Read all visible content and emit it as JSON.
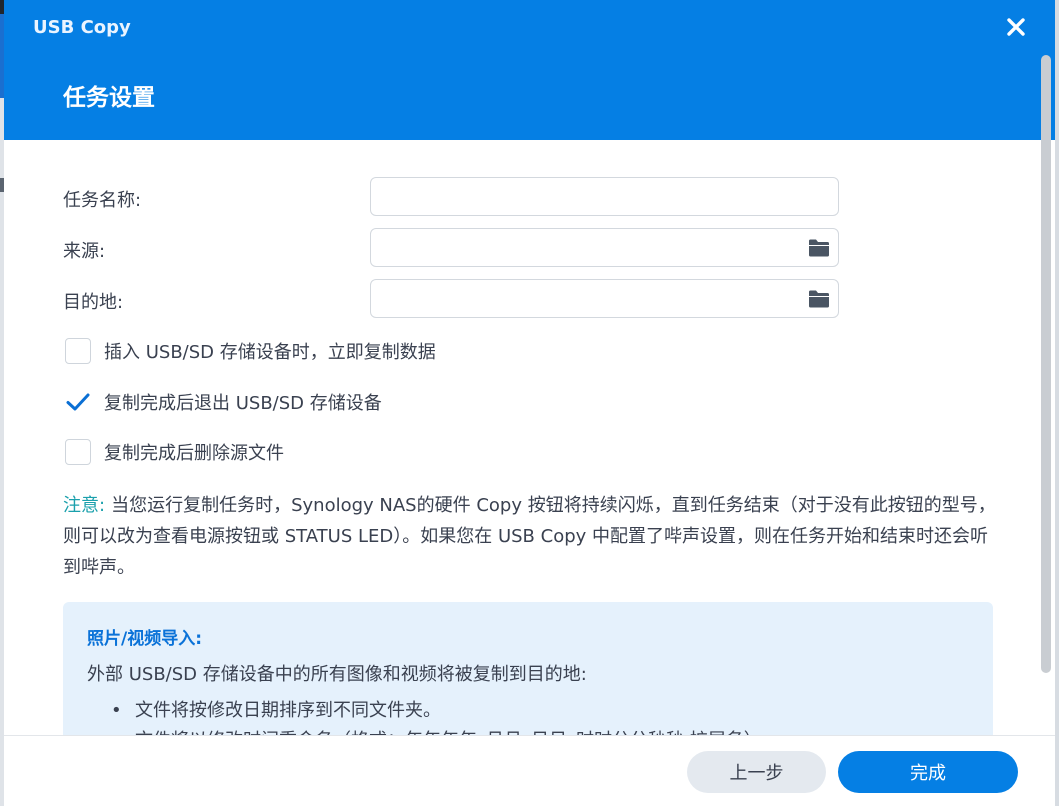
{
  "window": {
    "app_title": "USB Copy",
    "step_title": "任务设置"
  },
  "form": {
    "task_name": {
      "label": "任务名称:",
      "value": ""
    },
    "source": {
      "label": "来源:",
      "value": ""
    },
    "destination": {
      "label": "目的地:",
      "value": ""
    }
  },
  "options": [
    {
      "label": "插入 USB/SD 存储设备时，立即复制数据",
      "checked": false
    },
    {
      "label": "复制完成后退出 USB/SD 存储设备",
      "checked": true
    },
    {
      "label": "复制完成后删除源文件",
      "checked": false
    }
  ],
  "note": {
    "label": "注意:",
    "text": "当您运行复制任务时，Synology NAS的硬件 Copy 按钮将持续闪烁，直到任务结束（对于没有此按钮的型号，则可以改为查看电源按钮或 STATUS LED）。如果您在 USB Copy 中配置了哔声设置，则在任务开始和结束时还会听到哔声。"
  },
  "info": {
    "title": "照片/视频导入:",
    "description": "外部 USB/SD 存储设备中的所有图像和视频将被复制到目的地:",
    "bullets": [
      "文件将按修改日期排序到不同文件夹。",
      "文件将以修改时间重命名（格式：年年年年_月月_日日_时时分分秒秒.扩展名）。"
    ]
  },
  "footer": {
    "back_label": "上一步",
    "done_label": "完成"
  },
  "colors": {
    "header": "#057fe4",
    "accent": "#057fe4",
    "note_label": "#1aa0ac",
    "info_bg": "#e5f1fc"
  },
  "icons": {
    "close": "close-icon",
    "folder": "folder-icon",
    "check": "checkmark-icon"
  }
}
